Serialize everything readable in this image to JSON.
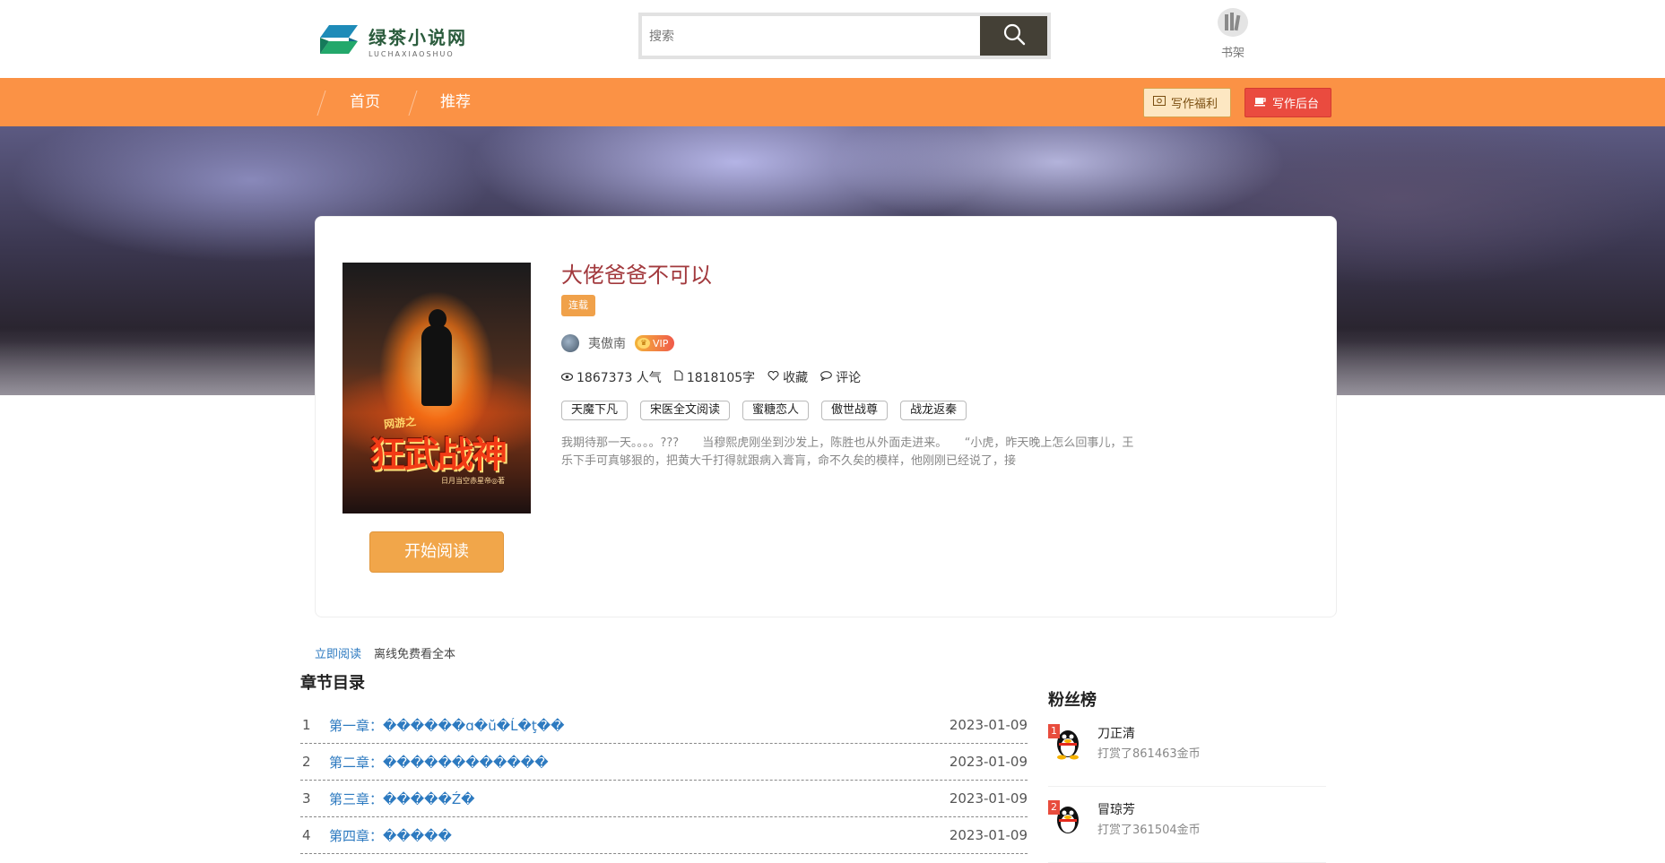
{
  "header": {
    "logo_cn": "绿茶小说网",
    "logo_en": "LUCHAXIAOSHUO",
    "search_placeholder": "搜索",
    "shelf_label": "书架"
  },
  "nav": {
    "items": [
      {
        "label": "首页"
      },
      {
        "label": "推荐"
      }
    ],
    "welfare_label": "写作福利",
    "backend_label": "写作后台"
  },
  "book": {
    "title": "大佬爸爸不可以",
    "status": "连载",
    "author": "夷傲南",
    "vip_label": "VIP",
    "popularity": "1867373 人气",
    "word_count": "1818105字",
    "favorite_label": "收藏",
    "comment_label": "评论",
    "tags": [
      "天魔下凡",
      "宋医全文阅读",
      "蜜糖恋人",
      "傲世战尊",
      "战龙返秦"
    ],
    "intro": "我期待那一天。。。。???　　当穆熙虎刚坐到沙发上，陈胜也从外面走进来。　　“小虎，昨天晚上怎么回事儿，王乐下手可真够狠的，把黄大千打得就跟病入膏肓，命不久矣的模样，他刚刚已经说了，接",
    "read_button": "开始阅读",
    "cover": {
      "subtitle": "网游之",
      "title": "狂武战神",
      "author": "日月当空赤星帝◎著"
    }
  },
  "chapters": {
    "tabs": [
      "立即阅读",
      "离线免费看全本"
    ],
    "section_title": "章节目录",
    "items": [
      {
        "num": "1",
        "title": "第一章：������ɑ�ŭ�Ĺ�ţ��",
        "date": "2023-01-09"
      },
      {
        "num": "2",
        "title": "第二章：������������",
        "date": "2023-01-09"
      },
      {
        "num": "3",
        "title": "第三章：�����Ź�",
        "date": "2023-01-09"
      },
      {
        "num": "4",
        "title": "第四章：�����",
        "date": "2023-01-09"
      }
    ]
  },
  "fans": {
    "title": "粉丝榜",
    "items": [
      {
        "rank": "1",
        "name": "刀正清",
        "desc": "打赏了861463金币"
      },
      {
        "rank": "2",
        "name": "冒琼芳",
        "desc": "打赏了361504金币"
      }
    ]
  },
  "colors": {
    "nav_bg": "#fb9245",
    "title_red": "#a2393d",
    "link_blue": "#2d7ac0",
    "read_button": "#f1a64a"
  }
}
